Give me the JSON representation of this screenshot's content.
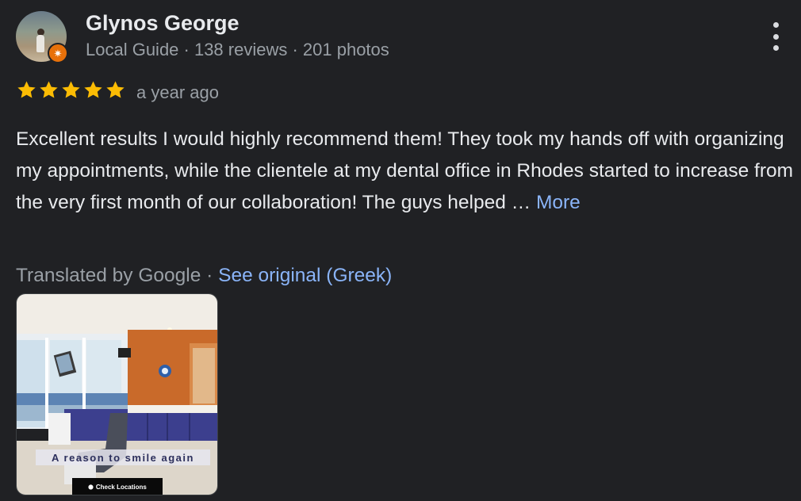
{
  "reviewer": {
    "name": "Glynos George",
    "meta": "Local Guide · 138 reviews · 201 photos",
    "avatar_icon": "user-avatar",
    "badge_icon": "local-guide-star-icon",
    "badge_color": "#e8710a"
  },
  "rating": {
    "stars": 5,
    "star_color": "#fbbc04",
    "time": "a year ago"
  },
  "review": {
    "text": "Excellent results I would highly recommend them! They took my hands off with organizing my appointments, while the clientele at my dental office in Rhodes started to increase from the very first month of our collaboration! The guys helped …",
    "more_label": "More"
  },
  "translation": {
    "label": "Translated by Google · ",
    "see_original_label": "See original (Greek)"
  },
  "photo": {
    "caption": "A reason to smile again",
    "button_label": "Check Locations",
    "button_icon": "location-pin-icon"
  },
  "colors": {
    "background": "#202124",
    "primary_text": "#e8eaed",
    "secondary_text": "#9aa0a6",
    "link": "#8ab4f8"
  }
}
